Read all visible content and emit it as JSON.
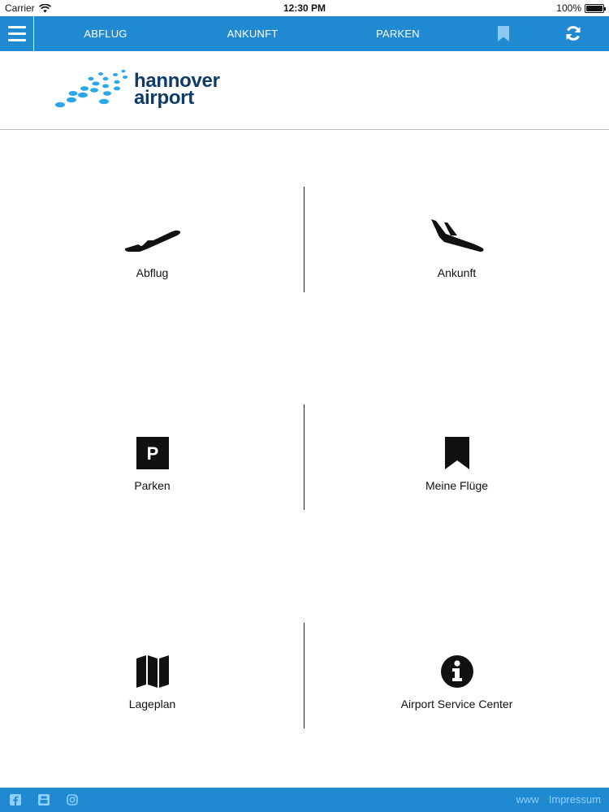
{
  "status_bar": {
    "carrier": "Carrier",
    "time": "12:30 PM",
    "battery": "100%",
    "battery_level": 1.0
  },
  "nav": {
    "abflug": "ABFLUG",
    "ankunft": "ANKUNFT",
    "parken": "PARKEN",
    "bookmark_icon": "bookmark-icon",
    "refresh_icon": "refresh-icon",
    "menu_icon": "hamburger-menu-icon"
  },
  "logo": {
    "line1": "hannover",
    "line2": "airport"
  },
  "tiles": [
    {
      "label": "Abflug",
      "icon": "departure-plane-icon"
    },
    {
      "label": "Ankunft",
      "icon": "arrival-plane-icon"
    },
    {
      "label": "Parken",
      "icon": "parking-icon"
    },
    {
      "label": "Meine Flüge",
      "icon": "bookmark-icon"
    },
    {
      "label": "Lageplan",
      "icon": "map-icon"
    },
    {
      "label": "Airport Service Center",
      "icon": "info-icon"
    }
  ],
  "footer": {
    "www": "www",
    "impressum": "Impressum",
    "social_icons": [
      "facebook-icon",
      "youtube-icon",
      "instagram-icon"
    ]
  },
  "colors": {
    "brand_blue": "#1f8ad2",
    "logo_navy": "#0f3b66",
    "logo_dots": "#2aa7e8",
    "footer_link": "#8fd0ff"
  }
}
